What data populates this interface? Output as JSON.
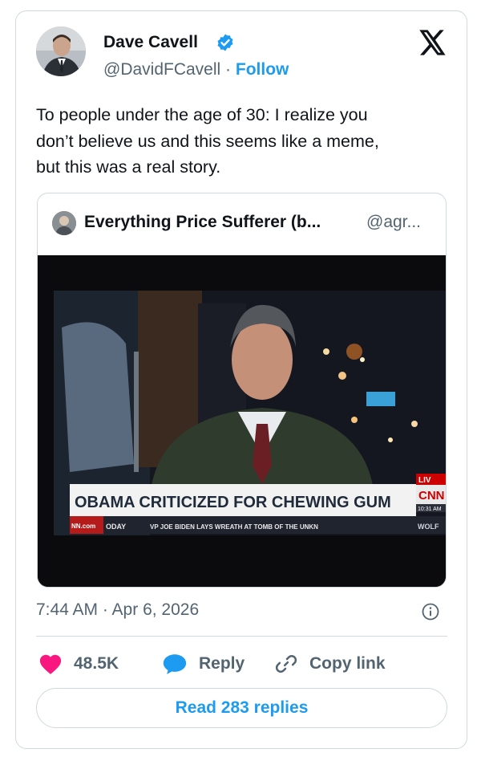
{
  "author": {
    "name": "Dave Cavell",
    "handle": "@DavidFCavell",
    "separator": "·",
    "follow_label": "Follow"
  },
  "tweet": {
    "lines": [
      "To people under the age of 30: I realize you",
      "don’t believe us and this seems like a meme,",
      "but this was a real story."
    ]
  },
  "quoted": {
    "name": "Everything Price Sufferer (b...",
    "handle": "@agr...",
    "media": {
      "headline": "OBAMA CRITICIZED FOR CHEWING GUM",
      "ticker": "VP JOE BIDEN LAYS WREATH AT TOMB OF THE UNKN",
      "ticker_left": "ODAY",
      "site": "NN.com",
      "network": "CNN",
      "live": "LIV",
      "time": "10:31 AM",
      "show": "WOLF"
    }
  },
  "meta": {
    "timestamp": "7:44 AM · Apr 6, 2026"
  },
  "actions": {
    "likes": "48.5K",
    "reply": "Reply",
    "copy_link": "Copy link"
  },
  "read_replies": "Read 283 replies",
  "colors": {
    "accent": "#1d9bf0",
    "like": "#f91880",
    "text": "#0f1419",
    "muted": "#536471",
    "border": "#cfd9de"
  }
}
